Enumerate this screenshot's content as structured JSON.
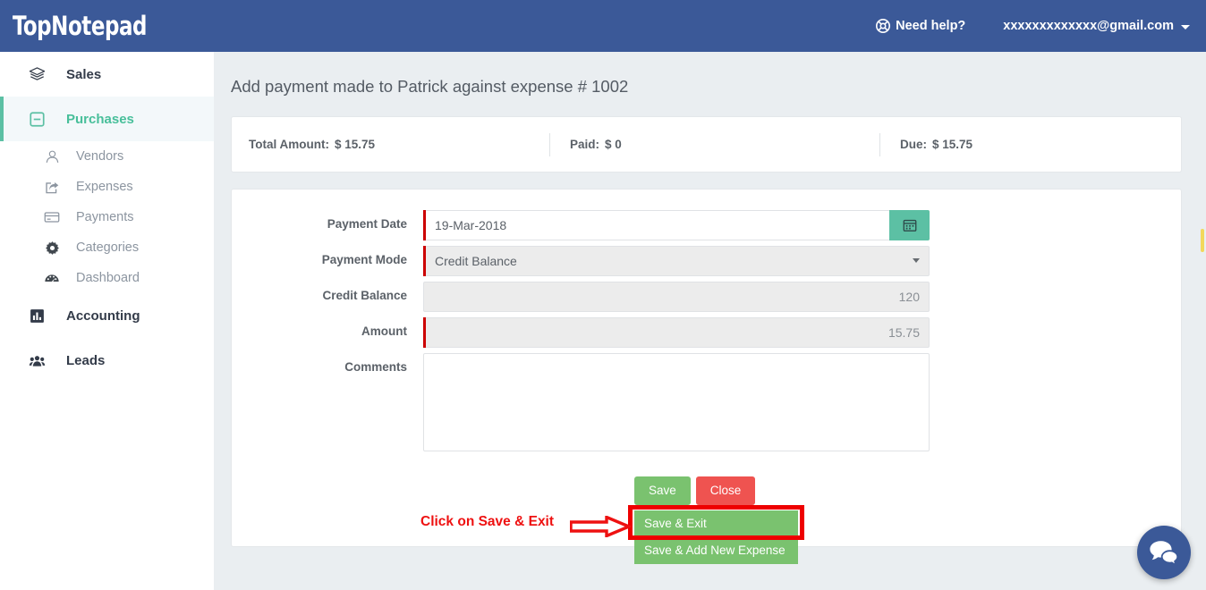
{
  "header": {
    "logo_top": "Top",
    "logo_note": "Notepad",
    "need_help": "Need help?",
    "need_help_icon": "life-ring-icon",
    "user_email": "xxxxxxxxxxxxx@gmail.com",
    "caret_icon": "caret-down-icon",
    "bg_color": "#3b5998"
  },
  "sidebar": {
    "items": [
      {
        "label": "Sales",
        "icon": "layers-icon",
        "active": false
      },
      {
        "label": "Purchases",
        "icon": "minus-square-icon",
        "active": true
      }
    ],
    "sub_items": [
      {
        "label": "Vendors",
        "icon": "user-icon"
      },
      {
        "label": "Expenses",
        "icon": "share-export-icon"
      },
      {
        "label": "Payments",
        "icon": "credit-card-icon"
      },
      {
        "label": "Categories",
        "icon": "gear-icon"
      },
      {
        "label": "Dashboard",
        "icon": "tachometer-icon"
      }
    ],
    "items_after": [
      {
        "label": "Accounting",
        "icon": "bar-chart-icon",
        "active": false
      },
      {
        "label": "Leads",
        "icon": "users-group-icon",
        "active": false
      }
    ],
    "active_color": "#48bf9a",
    "accent_bar_color": "#5cc0a4"
  },
  "main": {
    "page_title": "Add payment made to Patrick against expense # 1002",
    "summary": {
      "total_label": "Total Amount:",
      "total_value": "$ 15.75",
      "paid_label": "Paid:",
      "paid_value": "$ 0",
      "due_label": "Due:",
      "due_value": "$ 15.75"
    },
    "form": {
      "payment_date_label": "Payment Date",
      "payment_date_value": "19-Mar-2018",
      "calendar_icon": "calendar-icon",
      "payment_mode_label": "Payment Mode",
      "payment_mode_value": "Credit Balance",
      "payment_mode_options": [
        "Credit Balance"
      ],
      "credit_balance_label": "Credit Balance",
      "credit_balance_value": "120",
      "amount_label": "Amount",
      "amount_value": "15.75",
      "comments_label": "Comments",
      "comments_value": "",
      "comments_placeholder": ""
    },
    "buttons": {
      "save": "Save",
      "close": "Close",
      "save_exit": "Save & Exit",
      "save_add_new": "Save & Add New Expense",
      "save_color": "#7ac26f",
      "close_color": "#ef5350"
    },
    "annotation": {
      "text": "Click on Save & Exit",
      "color": "#ee1111",
      "arrow_icon": "right-arrow-annotation-icon",
      "highlight_target": "Save & Exit"
    }
  },
  "chat_widget": {
    "icon": "chat-bubbles-icon",
    "color": "#3b5998"
  }
}
